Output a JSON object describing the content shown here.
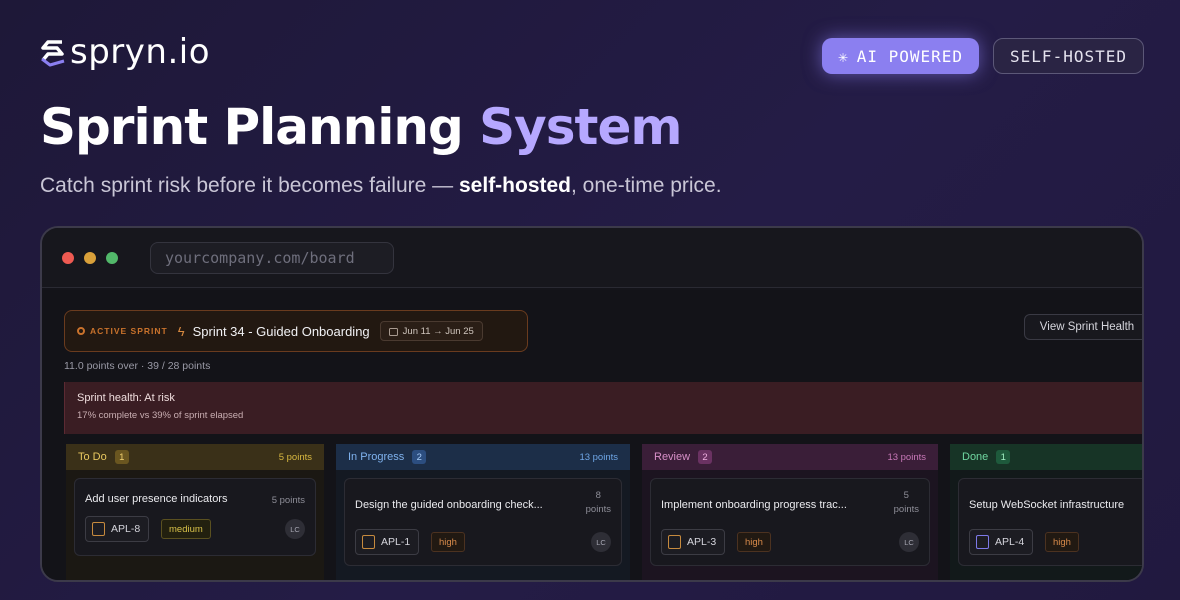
{
  "brand": {
    "name": "spryn.io"
  },
  "badges": {
    "ai_icon": "✳",
    "ai": "AI POWERED",
    "selfhosted": "SELF-HOSTED"
  },
  "hero": {
    "title_main": "Sprint Planning",
    "title_accent": "System",
    "subtitle_pre": "Catch sprint risk before it becomes failure — ",
    "subtitle_bold": "self-hosted",
    "subtitle_post": ", one-time price."
  },
  "browser": {
    "url": "yourcompany.com/board"
  },
  "sprint": {
    "active_label": "ACTIVE SPRINT",
    "name": "Sprint 34 - Guided Onboarding",
    "dates": "Jun 11 → Jun 25",
    "view_health": "View Sprint Health",
    "points_over": "11.0 points over · 39 / 28 points",
    "health_title": "Sprint health: At risk",
    "health_sub": "17% complete vs 39% of sprint elapsed"
  },
  "columns": [
    {
      "title": "To Do",
      "count": "1",
      "points": "5 points",
      "card": {
        "title": "Add user presence indicators",
        "points": "5 points",
        "key": "APL-8",
        "priority": "medium",
        "avatar": "LC"
      }
    },
    {
      "title": "In Progress",
      "count": "2",
      "points": "13 points",
      "card": {
        "title": "Design the guided onboarding check...",
        "points_num": "8",
        "points_unit": "points",
        "key": "APL-1",
        "priority": "high",
        "avatar": "LC"
      }
    },
    {
      "title": "Review",
      "count": "2",
      "points": "13 points",
      "card": {
        "title": "Implement onboarding progress trac...",
        "points_num": "5",
        "points_unit": "points",
        "key": "APL-3",
        "priority": "high",
        "avatar": "LC"
      }
    },
    {
      "title": "Done",
      "count": "1",
      "points": "",
      "card": {
        "title": "Setup WebSocket infrastructure",
        "key": "APL-4",
        "priority": "high"
      }
    }
  ],
  "colors": {
    "accent": "#b6a8ff",
    "badge_ai": "#8b7ff0",
    "todo": "#c8a032",
    "in_progress": "#5b9be8",
    "review": "#c66fb8",
    "done": "#4ec38a",
    "risk": "#3a1d23"
  }
}
